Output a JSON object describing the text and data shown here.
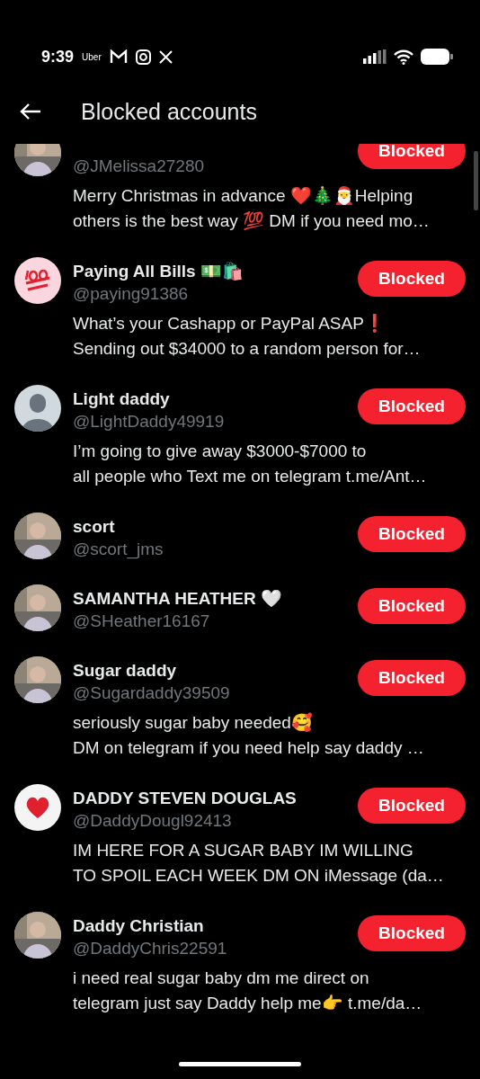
{
  "status_bar": {
    "time": "9:39",
    "app_label": "Uber"
  },
  "header": {
    "title": "Blocked accounts"
  },
  "accounts": [
    {
      "handle": "@JMelissa27280",
      "bio": [
        "Merry Christmas in advance ❤️🎄🎅Helping",
        "others is the best way 💯 DM if you need mo…"
      ],
      "button": "Blocked",
      "blocked": true
    },
    {
      "avatar": {
        "kind": "hundred"
      },
      "name": "Paying All Bills 💵🛍️",
      "handle": "@paying91386",
      "bio": [
        "What’s your Cashapp or PayPal ASAP❗",
        "Sending out $34000 to a random person for…"
      ],
      "button": "Blocked",
      "blocked": true
    },
    {
      "avatar": {
        "kind": "default"
      },
      "name": "Light daddy",
      "handle": "@LightDaddy49919",
      "bio": [
        "I’m going to give away $3000-$7000 to",
        "all people who Text me on telegram t.me/Ant…"
      ],
      "button": "Blocked",
      "blocked": true
    },
    {
      "name": "scort",
      "handle": "@scort_jms",
      "button": "Blocked",
      "blocked": true
    },
    {
      "name": "SAMANTHA HEATHER 🤍",
      "handle": "@SHeather16167",
      "button": "Blocked",
      "blocked": true
    },
    {
      "name": "Sugar daddy",
      "handle": "@Sugardaddy39509",
      "bio": [
        "seriously sugar baby needed🥰",
        "DM on telegram if you need help say daddy …"
      ],
      "button": "Blocked",
      "blocked": true
    },
    {
      "avatar": {
        "kind": "heart"
      },
      "name": "DADDY STEVEN DOUGLAS",
      "handle": "@DaddyDougl92413",
      "bio": [
        "IM HERE FOR A SUGAR BABY IM WILLING",
        "TO SPOIL EACH WEEK DM ON  iMessage (da…"
      ],
      "button": "Blocked",
      "blocked": true
    },
    {
      "name": "Daddy Christian",
      "handle": "@DaddyChris22591",
      "bio": [
        "i need real sugar baby  dm me direct on",
        "telegram just say Daddy help me👉 t.me/da…"
      ],
      "button": "Blocked",
      "blocked": true
    }
  ]
}
